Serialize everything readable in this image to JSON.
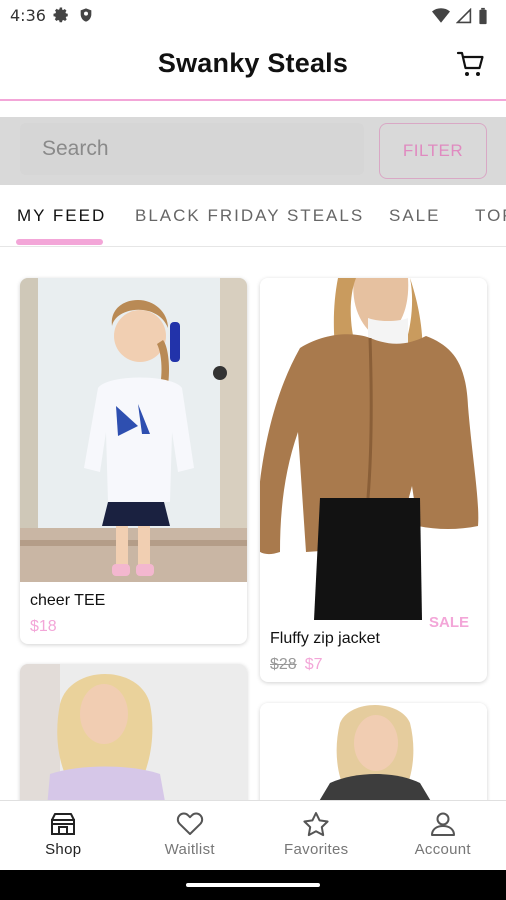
{
  "status_bar": {
    "time": "4:36",
    "icons": [
      "gear-icon",
      "shield-icon",
      "wifi-icon",
      "signal-icon",
      "battery-icon"
    ]
  },
  "app": {
    "title": "Swanky Steals",
    "accent_color": "#f3a6d8"
  },
  "search": {
    "placeholder": "Search",
    "filter_label": "FILTER"
  },
  "tabs": [
    {
      "label": "MY FEED",
      "active": true
    },
    {
      "label": "BLACK FRIDAY STEALS",
      "active": false
    },
    {
      "label": "SALE",
      "active": false
    },
    {
      "label": "TOP",
      "active": false
    }
  ],
  "products": [
    {
      "name": "cheer TEE",
      "price": "$18",
      "old_price": "",
      "sale": false
    },
    {
      "name": "Fluffy zip jacket",
      "price": "$7",
      "old_price": "$28",
      "sale": true,
      "badge": "SALE"
    },
    {
      "name": "",
      "price": "",
      "old_price": "",
      "sale": false
    },
    {
      "name": "",
      "price": "",
      "old_price": "",
      "sale": false
    }
  ],
  "bottom_nav": [
    {
      "label": "Shop",
      "icon": "store-icon",
      "active": true
    },
    {
      "label": "Waitlist",
      "icon": "heart-icon",
      "active": false
    },
    {
      "label": "Favorites",
      "icon": "star-icon",
      "active": false
    },
    {
      "label": "Account",
      "icon": "person-icon",
      "active": false
    }
  ]
}
